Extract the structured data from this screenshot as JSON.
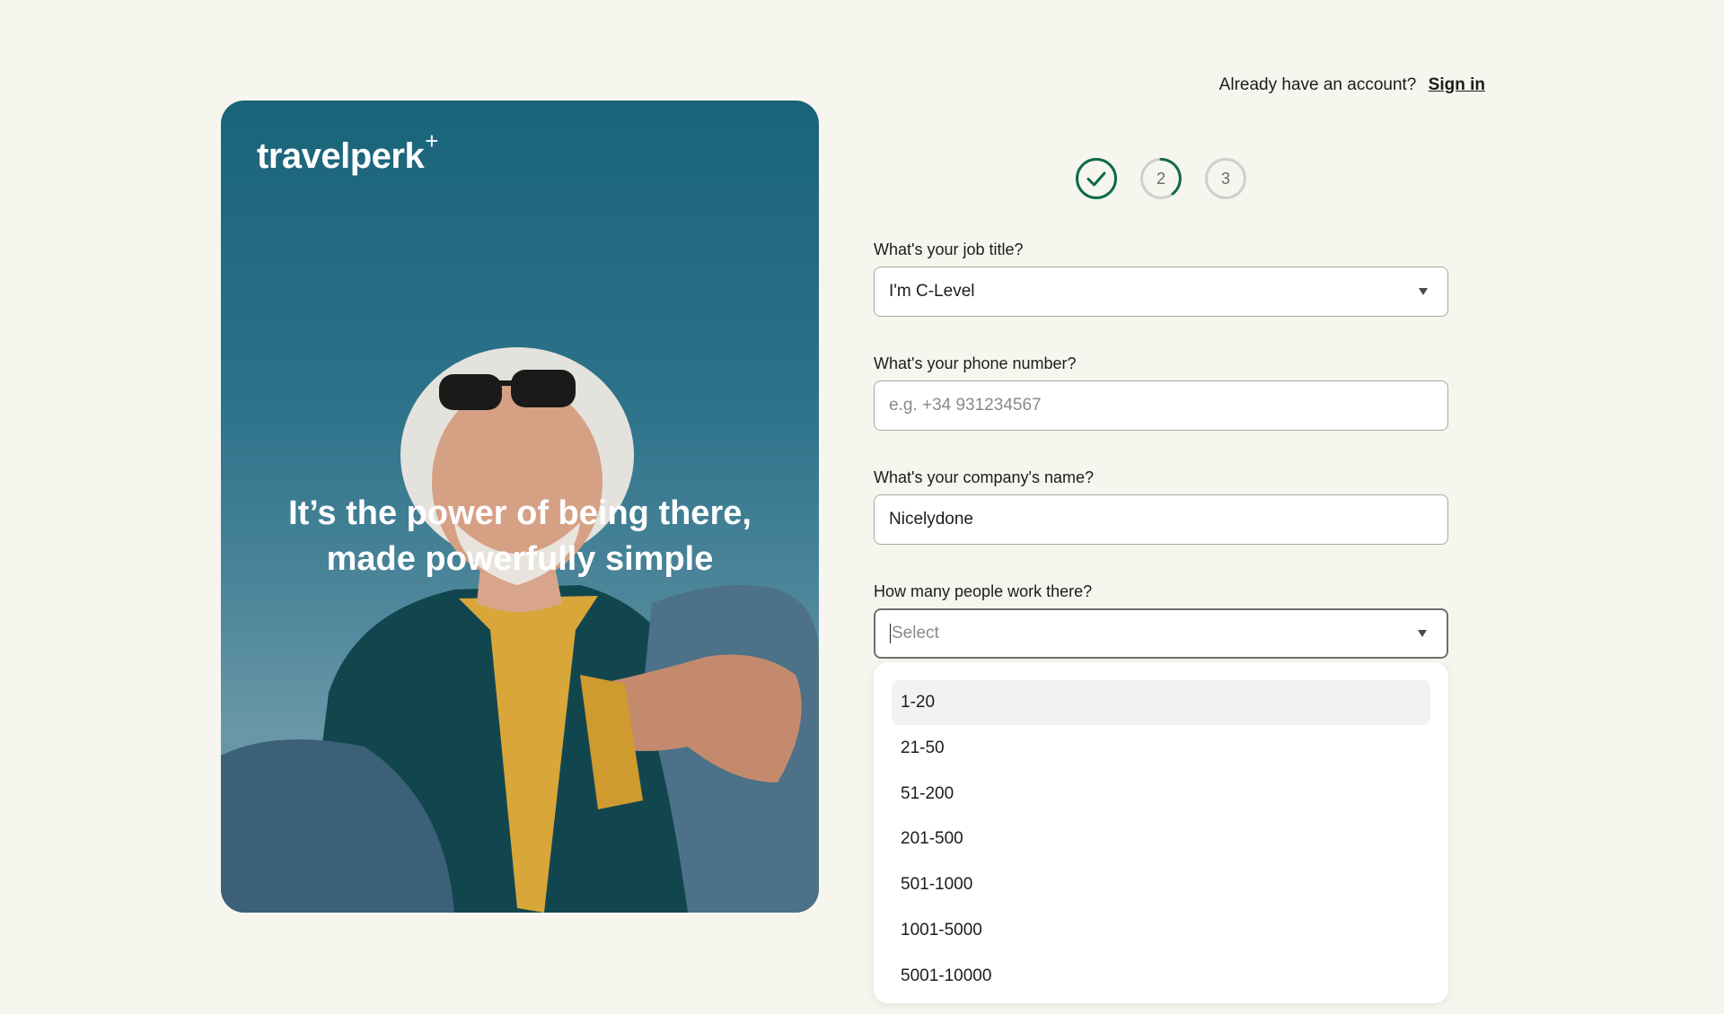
{
  "brand": {
    "name": "travelperk",
    "plus": "+"
  },
  "hero": {
    "tagline_line1": "It’s the power of being there,",
    "tagline_line2": "made powerfully simple"
  },
  "header": {
    "prompt": "Already have an account?",
    "signin_label": "Sign in"
  },
  "stepper": {
    "steps": [
      {
        "label": "",
        "state": "complete"
      },
      {
        "label": "2",
        "state": "in-progress"
      },
      {
        "label": "3",
        "state": "pending"
      }
    ],
    "colors": {
      "complete": "#0f6b45",
      "pending": "#cfcfcb"
    }
  },
  "form": {
    "job_title": {
      "label": "What's your job title?",
      "value": "I'm C-Level"
    },
    "phone": {
      "label": "What's your phone number?",
      "placeholder": "e.g. +34 931234567",
      "value": ""
    },
    "company": {
      "label": "What's your company's name?",
      "value": "Nicelydone"
    },
    "size": {
      "label": "How many people work there?",
      "placeholder": "Select",
      "options": [
        "1-20",
        "21-50",
        "51-200",
        "201-500",
        "501-1000",
        "1001-5000",
        "5001-10000"
      ]
    }
  }
}
